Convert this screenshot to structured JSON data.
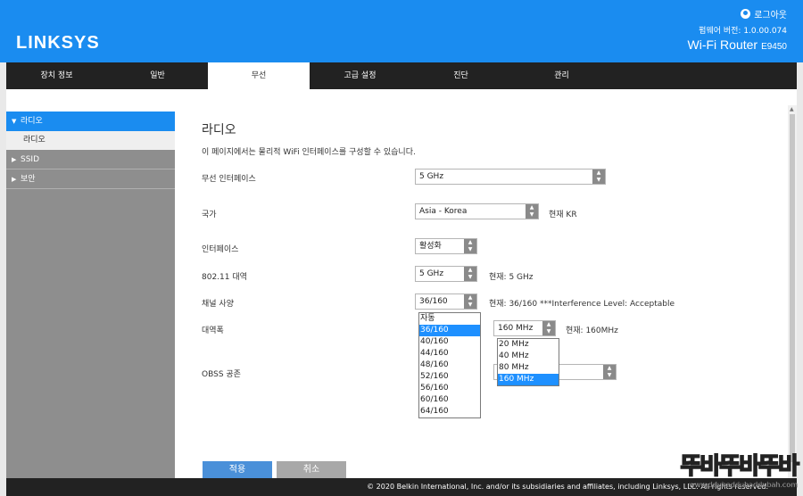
{
  "header": {
    "logo": "LINKSYS",
    "logout": "로그아웃",
    "firmware": "펌웨어 버전: 1.0.00.074",
    "router_name": "Wi-Fi Router",
    "router_model": "E9450"
  },
  "nav": {
    "tabs": [
      "장치 정보",
      "일반",
      "무선",
      "고급 설정",
      "진단",
      "관리"
    ],
    "active": "무선"
  },
  "sidebar": {
    "radio": "라디오",
    "radio_sub": "라디오",
    "ssid": "SSID",
    "security": "보안"
  },
  "main": {
    "title": "라디오",
    "description": "이 페이지에서는 물리적 WiFi 인터페이스를 구성할 수 있습니다.",
    "fields": {
      "wireless_interface": {
        "label": "무선 인터페이스",
        "value": "5 GHz"
      },
      "country": {
        "label": "국가",
        "value": "Asia - Korea",
        "current": "현재 KR"
      },
      "interface": {
        "label": "인터페이스",
        "value": "활성화"
      },
      "band": {
        "label": "802.11 대역",
        "value": "5 GHz",
        "current": "현재: 5 GHz"
      },
      "channel": {
        "label": "채널 사양",
        "value": "36/160",
        "current": "현재: 36/160 ***Interference Level: Acceptable"
      },
      "bandwidth": {
        "label": "대역폭",
        "value": "160 MHz",
        "current": "현재: 160MHz"
      },
      "obss": {
        "label": "OBSS 공존"
      }
    },
    "channel_options": [
      "자동",
      "36/160",
      "40/160",
      "44/160",
      "48/160",
      "52/160",
      "56/160",
      "60/160",
      "64/160"
    ],
    "channel_selected": "36/160",
    "bandwidth_options": [
      "20 MHz",
      "40 MHz",
      "80 MHz",
      "160 MHz"
    ],
    "bandwidth_selected": "160 MHz"
  },
  "buttons": {
    "apply": "적용",
    "cancel": "취소"
  },
  "footer": "© 2020 Belkin International, Inc. and/or its subsidiaries and affiliates, including Linksys, LLC. All rights reserved.",
  "watermark": {
    "text": "뚜바뚜바뚜바",
    "url": "www.ddubaddubaddubah.com"
  }
}
